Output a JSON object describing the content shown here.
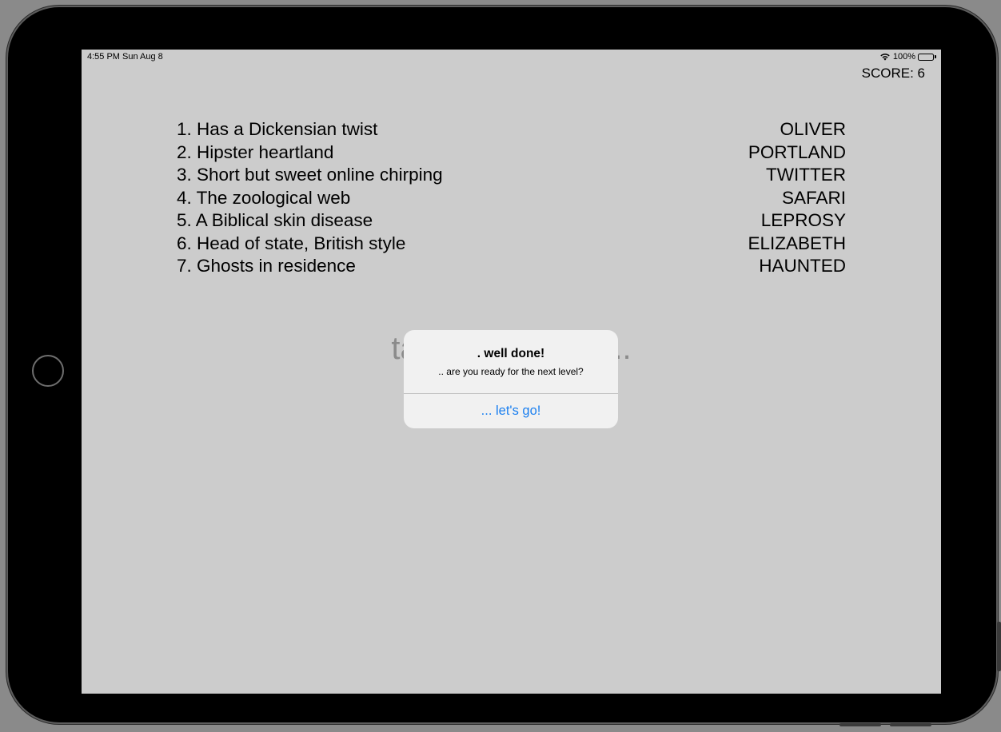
{
  "status_bar": {
    "time": "4:55 PM  Sun Aug 8",
    "battery": "100%",
    "wifi_icon": "wifi-icon",
    "battery_icon": "battery-icon"
  },
  "score_label": "SCORE: 6",
  "clues": [
    {
      "clue": "1. Has a Dickensian twist",
      "answer": "OLIVER"
    },
    {
      "clue": "2. Hipster heartland",
      "answer": "PORTLAND"
    },
    {
      "clue": "3. Short but sweet online chirping",
      "answer": "TWITTER"
    },
    {
      "clue": "4. The zoological web",
      "answer": "SAFARI"
    },
    {
      "clue": "5. A Biblical skin disease",
      "answer": "LEPROSY"
    },
    {
      "clue": "6. Head of state, British style",
      "answer": "ELIZABETH"
    },
    {
      "clue": "7. Ghosts in residence",
      "answer": "HAUNTED"
    }
  ],
  "background_text": "tap to progress...",
  "alert": {
    "title": ". well done!",
    "message": ".. are you ready for the next level?",
    "button_label": "... let's go!"
  },
  "colors": {
    "screen_bg": "#cccccc",
    "alert_bg": "#f1f1f1",
    "accent": "#1a7ff0",
    "faded_text": "#8b8b8b"
  }
}
